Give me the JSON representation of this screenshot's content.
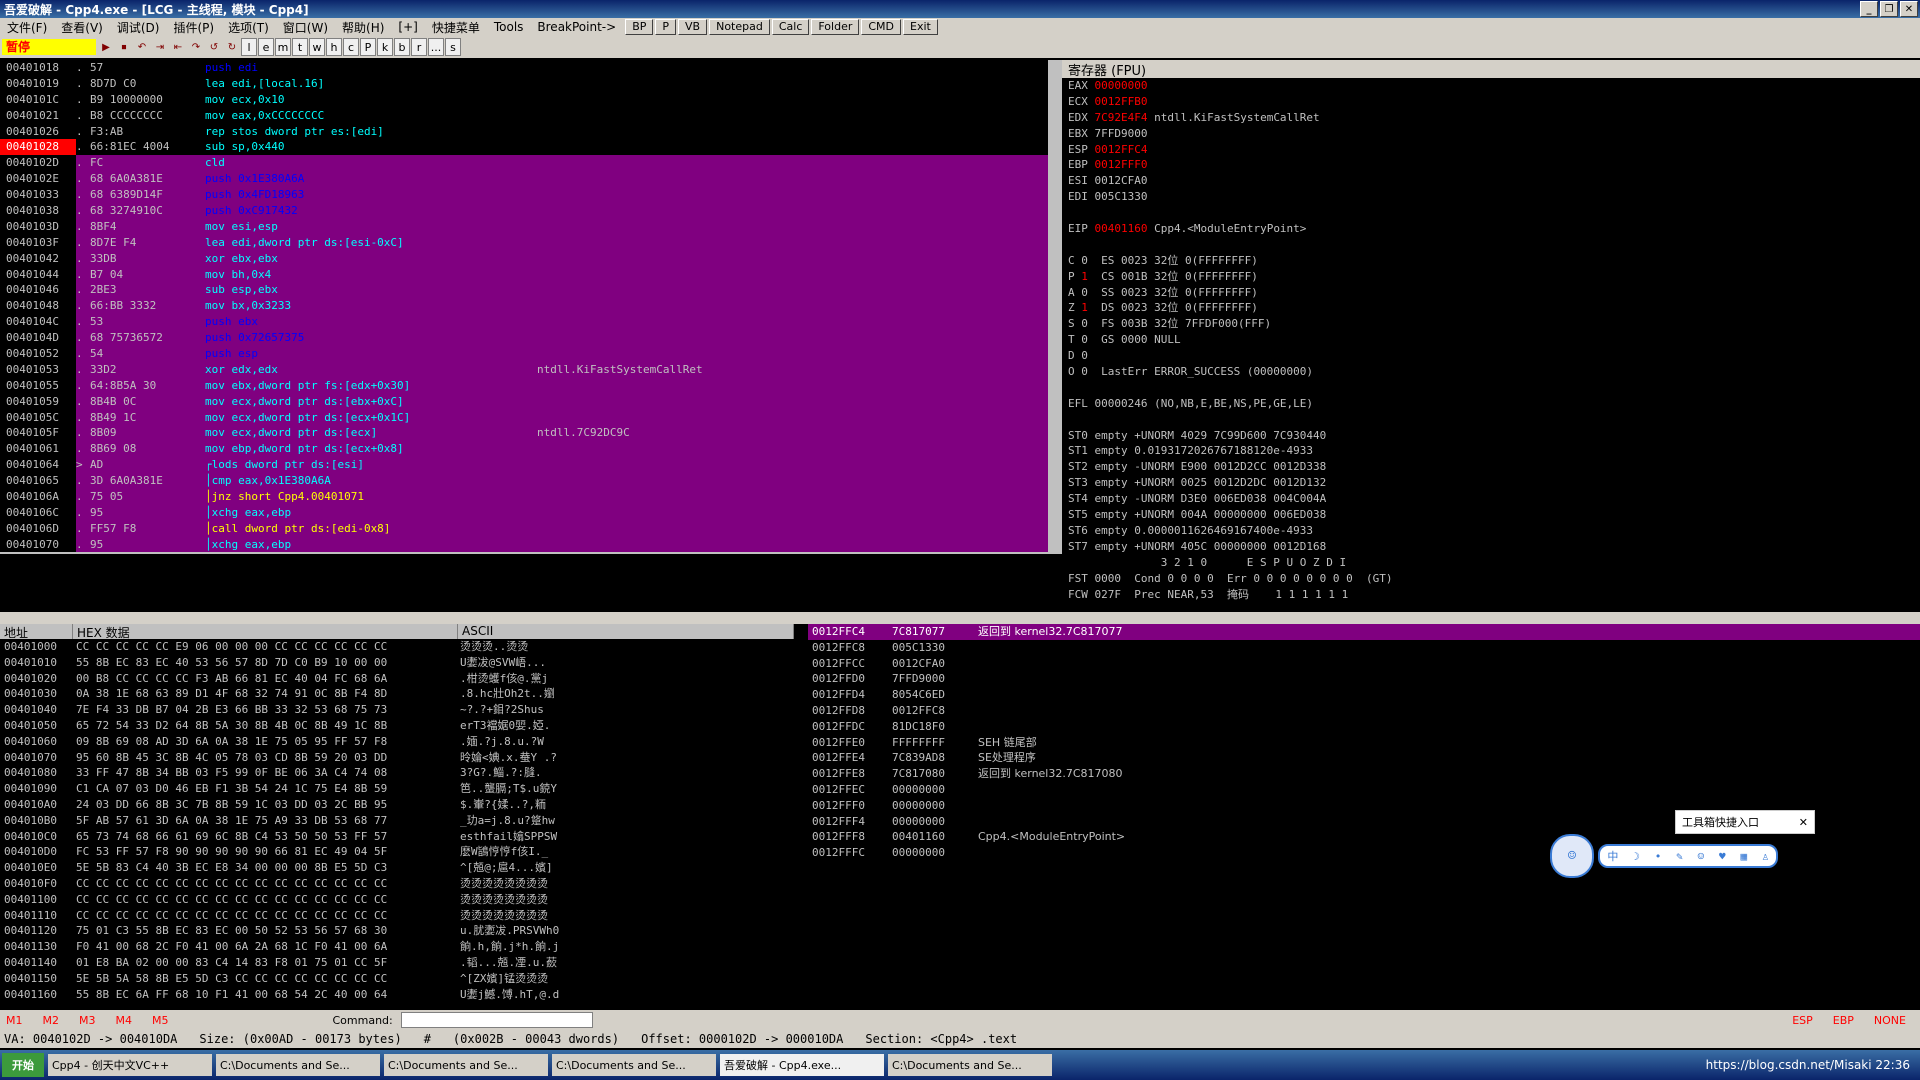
{
  "window": {
    "title": "吾爱破解 - Cpp4.exe - [LCG - 主线程, 模块 - Cpp4]"
  },
  "menu": {
    "items": [
      "文件(F)",
      "查看(V)",
      "调试(D)",
      "插件(P)",
      "选项(T)",
      "窗口(W)",
      "帮助(H)",
      "[+]",
      "快捷菜单",
      "Tools",
      "BreakPoint->"
    ],
    "buttons": [
      "BP",
      "P",
      "VB",
      "Notepad",
      "Calc",
      "Folder",
      "CMD",
      "Exit"
    ]
  },
  "toolbar": {
    "status": "暂停",
    "letters": [
      "l",
      "e",
      "m",
      "t",
      "w",
      "h",
      "c",
      "P",
      "k",
      "b",
      "r",
      "...",
      "s"
    ]
  },
  "disasm": {
    "rows": [
      {
        "addr": "00401018",
        "mk": ".",
        "hex": "57",
        "asm": "push edi",
        "cmt": "",
        "purple": false,
        "eip": false
      },
      {
        "addr": "00401019",
        "mk": ".",
        "hex": "8D7D C0",
        "asm": "lea edi,[local.16]",
        "cmt": "",
        "purple": false,
        "eip": false
      },
      {
        "addr": "0040101C",
        "mk": ".",
        "hex": "B9 10000000",
        "asm": "mov ecx,0x10",
        "cmt": "",
        "purple": false,
        "eip": false
      },
      {
        "addr": "00401021",
        "mk": ".",
        "hex": "B8 CCCCCCCC",
        "asm": "mov eax,0xCCCCCCCC",
        "cmt": "",
        "purple": false,
        "eip": false
      },
      {
        "addr": "00401026",
        "mk": ".",
        "hex": "F3:AB",
        "asm": "rep stos dword ptr es:[edi]",
        "cmt": "",
        "purple": false,
        "eip": false
      },
      {
        "addr": "00401028",
        "mk": ".",
        "hex": "66:81EC 4004",
        "asm": "sub sp,0x440",
        "cmt": "",
        "purple": false,
        "eip": true
      },
      {
        "addr": "0040102D",
        "mk": ".",
        "hex": "FC",
        "asm": "cld",
        "cmt": "",
        "purple": true,
        "eip": false
      },
      {
        "addr": "0040102E",
        "mk": ".",
        "hex": "68 6A0A381E",
        "asm": "push 0x1E380A6A",
        "cmt": "",
        "purple": true,
        "eip": false
      },
      {
        "addr": "00401033",
        "mk": ".",
        "hex": "68 6389D14F",
        "asm": "push 0x4FD18963",
        "cmt": "",
        "purple": true,
        "eip": false
      },
      {
        "addr": "00401038",
        "mk": ".",
        "hex": "68 3274910C",
        "asm": "push 0xC917432",
        "cmt": "",
        "purple": true,
        "eip": false
      },
      {
        "addr": "0040103D",
        "mk": ".",
        "hex": "8BF4",
        "asm": "mov esi,esp",
        "cmt": "",
        "purple": true,
        "eip": false
      },
      {
        "addr": "0040103F",
        "mk": ".",
        "hex": "8D7E F4",
        "asm": "lea edi,dword ptr ds:[esi-0xC]",
        "cmt": "",
        "purple": true,
        "eip": false
      },
      {
        "addr": "00401042",
        "mk": ".",
        "hex": "33DB",
        "asm": "xor ebx,ebx",
        "cmt": "",
        "purple": true,
        "eip": false
      },
      {
        "addr": "00401044",
        "mk": ".",
        "hex": "B7 04",
        "asm": "mov bh,0x4",
        "cmt": "",
        "purple": true,
        "eip": false
      },
      {
        "addr": "00401046",
        "mk": ".",
        "hex": "2BE3",
        "asm": "sub esp,ebx",
        "cmt": "",
        "purple": true,
        "eip": false
      },
      {
        "addr": "00401048",
        "mk": ".",
        "hex": "66:BB 3332",
        "asm": "mov bx,0x3233",
        "cmt": "",
        "purple": true,
        "eip": false
      },
      {
        "addr": "0040104C",
        "mk": ".",
        "hex": "53",
        "asm": "push ebx",
        "cmt": "",
        "purple": true,
        "eip": false
      },
      {
        "addr": "0040104D",
        "mk": ".",
        "hex": "68 75736572",
        "asm": "push 0x72657375",
        "cmt": "",
        "purple": true,
        "eip": false
      },
      {
        "addr": "00401052",
        "mk": ".",
        "hex": "54",
        "asm": "push esp",
        "cmt": "",
        "purple": true,
        "eip": false
      },
      {
        "addr": "00401053",
        "mk": ".",
        "hex": "33D2",
        "asm": "xor edx,edx",
        "cmt": "ntdll.KiFastSystemCallRet",
        "purple": true,
        "eip": false
      },
      {
        "addr": "00401055",
        "mk": ".",
        "hex": "64:8B5A 30",
        "asm": "mov ebx,dword ptr fs:[edx+0x30]",
        "cmt": "",
        "purple": true,
        "eip": false
      },
      {
        "addr": "00401059",
        "mk": ".",
        "hex": "8B4B 0C",
        "asm": "mov ecx,dword ptr ds:[ebx+0xC]",
        "cmt": "",
        "purple": true,
        "eip": false
      },
      {
        "addr": "0040105C",
        "mk": ".",
        "hex": "8B49 1C",
        "asm": "mov ecx,dword ptr ds:[ecx+0x1C]",
        "cmt": "",
        "purple": true,
        "eip": false
      },
      {
        "addr": "0040105F",
        "mk": ".",
        "hex": "8B09",
        "asm": "mov ecx,dword ptr ds:[ecx]",
        "cmt": "ntdll.7C92DC9C",
        "purple": true,
        "eip": false
      },
      {
        "addr": "00401061",
        "mk": ".",
        "hex": "8B69 08",
        "asm": "mov ebp,dword ptr ds:[ecx+0x8]",
        "cmt": "",
        "purple": true,
        "eip": false
      },
      {
        "addr": "00401064",
        "mk": ">",
        "hex": "AD",
        "asm": "┌lods dword ptr ds:[esi]",
        "cmt": "",
        "purple": true,
        "eip": false
      },
      {
        "addr": "00401065",
        "mk": ".",
        "hex": "3D 6A0A381E",
        "asm": "│cmp eax,0x1E380A6A",
        "cmt": "",
        "purple": true,
        "eip": false
      },
      {
        "addr": "0040106A",
        "mk": ".",
        "hex": "75 05",
        "asm": "│jnz short Cpp4.00401071",
        "cmt": "",
        "purple": true,
        "eip": false
      },
      {
        "addr": "0040106C",
        "mk": ".",
        "hex": "95",
        "asm": "│xchg eax,ebp",
        "cmt": "",
        "purple": true,
        "eip": false
      },
      {
        "addr": "0040106D",
        "mk": ".",
        "hex": "FF57 F8",
        "asm": "│call dword ptr ds:[edi-0x8]",
        "cmt": "",
        "purple": true,
        "eip": false
      },
      {
        "addr": "00401070",
        "mk": ".",
        "hex": "95",
        "asm": "│xchg eax,ebp",
        "cmt": "",
        "purple": true,
        "eip": false
      }
    ]
  },
  "registers": {
    "header": "寄存器 (FPU)",
    "lines": [
      {
        "name": "EAX",
        "val": "00000000",
        "txt": "",
        "red": true
      },
      {
        "name": "ECX",
        "val": "0012FFB0",
        "txt": "",
        "red": true
      },
      {
        "name": "EDX",
        "val": "7C92E4F4",
        "txt": "ntdll.KiFastSystemCallRet",
        "red": true
      },
      {
        "name": "EBX",
        "val": "7FFD9000",
        "txt": "",
        "red": false
      },
      {
        "name": "ESP",
        "val": "0012FFC4",
        "txt": "",
        "red": true
      },
      {
        "name": "EBP",
        "val": "0012FFF0",
        "txt": "",
        "red": true
      },
      {
        "name": "ESI",
        "val": "0012CFA0",
        "txt": "",
        "red": false
      },
      {
        "name": "EDI",
        "val": "005C1330",
        "txt": "",
        "red": false
      }
    ],
    "eip": {
      "name": "EIP",
      "val": "00401160",
      "txt": "Cpp4.<ModuleEntryPoint>"
    },
    "flags": [
      {
        "f": "C 0",
        "seg": "ES 0023 32位 0(FFFFFFFF)",
        "red": false
      },
      {
        "f": "P 1",
        "seg": "CS 001B 32位 0(FFFFFFFF)",
        "red": true
      },
      {
        "f": "A 0",
        "seg": "SS 0023 32位 0(FFFFFFFF)",
        "red": false
      },
      {
        "f": "Z 1",
        "seg": "DS 0023 32位 0(FFFFFFFF)",
        "red": true
      },
      {
        "f": "S 0",
        "seg": "FS 003B 32位 7FFDF000(FFF)",
        "red": false
      },
      {
        "f": "T 0",
        "seg": "GS 0000 NULL",
        "red": false
      },
      {
        "f": "D 0",
        "seg": "",
        "red": false
      },
      {
        "f": "O 0",
        "seg": "LastErr ERROR_SUCCESS (00000000)",
        "red": false
      }
    ],
    "efl": "EFL 00000246 (NO,NB,E,BE,NS,PE,GE,LE)",
    "st": [
      "ST0 empty +UNORM 4029 7C99D600 7C930440",
      "ST1 empty 0.0193172026767188120e-4933",
      "ST2 empty -UNORM E900 0012D2CC 0012D338",
      "ST3 empty +UNORM 0025 0012D2DC 0012D132",
      "ST4 empty -UNORM D3E0 006ED038 004C004A",
      "ST5 empty +UNORM 004A 00000000 006ED038",
      "ST6 empty 0.0000011626469167400e-4933",
      "ST7 empty +UNORM 405C 00000000 0012D168"
    ],
    "fpu_hdr": "              3 2 1 0      E S P U O Z D I",
    "fst": "FST 0000  Cond 0 0 0 0  Err 0 0 0 0 0 0 0 0  (GT)",
    "fcw": "FCW 027F  Prec NEAR,53  掩码    1 1 1 1 1 1"
  },
  "dump": {
    "headers": [
      "地址",
      "HEX 数据",
      "ASCII"
    ],
    "rows": [
      {
        "a": "00401000",
        "h": "CC CC CC CC CC E9 06 00 00 00 CC CC CC CC CC CC",
        "s": "烫烫烫..烫烫"
      },
      {
        "a": "00401010",
        "h": "55 8B EC 83 EC 40 53 56 57 8D 7D C0 B9 10 00 00",
        "s": "U嬱冹@SVW峿..."
      },
      {
        "a": "00401020",
        "h": "00 B8 CC CC CC CC F3 AB 66 81 EC 40 04 FC 68 6A",
        "s": ".柑烫蠖f侅@.黨j"
      },
      {
        "a": "00401030",
        "h": "0A 38 1E 68 63 89 D1 4F 68 32 74 91 0C 8B F4 8D",
        "s": ".8.hc壯Oh2t..嬼"
      },
      {
        "a": "00401040",
        "h": "7E F4 33 DB B7 04 2B E3 66 BB 33 32 53 68 75 73",
        "s": "~?.?+鉬?2Shus"
      },
      {
        "a": "00401050",
        "h": "65 72 54 33 D2 64 8B 5A 30 8B 4B 0C 8B 49 1C 8B",
        "s": "erT3襠婮0婯.婭."
      },
      {
        "a": "00401060",
        "h": "09 8B 69 08 AD 3D 6A 0A 38 1E 75 05 95 FF 57 F8",
        "s": ".媔.?j.8.u.?W"
      },
      {
        "a": "00401070",
        "h": "95 60 8B 45 3C 8B 4C 05 78 03 CD 8B 59 20 03 DD",
        "s": "昤婨<婰.x.蛬Y .?"
      },
      {
        "a": "00401080",
        "h": "33 FF 47 8B 34 BB 03 F5 99 0F BE 06 3A C4 74 08",
        "s": "3?G?.鯔.?:膖."
      },
      {
        "a": "00401090",
        "h": "C1 CA 07 03 D0 46 EB F1 3B 54 24 1C 75 E4 8B 59",
        "s": "笆..蠪膈;T$.u鋴Y"
      },
      {
        "a": "004010A0",
        "h": "24 03 DD 66 8B 3C 7B 8B 59 1C 03 DD 03 2C BB 95",
        "s": "$.輋?{媃..?,粫"
      },
      {
        "a": "004010B0",
        "h": "5F AB 57 61 3D 6A 0A 38 1E 75 A9 33 DB 53 68 77",
        "s": "_玏a=j.8.u?跾hw"
      },
      {
        "a": "004010C0",
        "h": "65 73 74 68 66 61 69 6C 8B C4 53 50 50 53 FF 57",
        "s": "esthfail嬆SPPSW"
      },
      {
        "a": "004010D0",
        "h": "FC 53 FF 57 F8 90 90 90 90 90 66 81 EC 49 04 5F",
        "s": "麽W鴲悙悙f侅I._"
      },
      {
        "a": "004010E0",
        "h": "5E 5B 83 C4 40 3B EC E8 34 00 00 00 8B E5 5D C3",
        "s": "^[兡@;扈4...嬪]"
      },
      {
        "a": "004010F0",
        "h": "CC CC CC CC CC CC CC CC CC CC CC CC CC CC CC CC",
        "s": "烫烫烫烫烫烫烫烫"
      },
      {
        "a": "00401100",
        "h": "CC CC CC CC CC CC CC CC CC CC CC CC CC CC CC CC",
        "s": "烫烫烫烫烫烫烫烫"
      },
      {
        "a": "00401110",
        "h": "CC CC CC CC CC CC CC CC CC CC CC CC CC CC CC CC",
        "s": "烫烫烫烫烫烫烫烫"
      },
      {
        "a": "00401120",
        "h": "75 01 C3 55 8B EC 83 EC 00 50 52 53 56 57 68 30",
        "s": "u.肬嬱冹.PRSVWh0"
      },
      {
        "a": "00401130",
        "h": "F0 41 00 68 2C F0 41 00 6A 2A 68 1C F0 41 00 6A",
        "s": "餉.h,餉.j*h.餉.j"
      },
      {
        "a": "00401140",
        "h": "01 E8 BA 02 00 00 83 C4 14 83 F8 01 75 01 CC 5F",
        "s": ".韬...兡.凐.u.蘝"
      },
      {
        "a": "00401150",
        "h": "5E 5B 5A 58 8B E5 5D C3 CC CC CC CC CC CC CC CC",
        "s": "^[ZX嬪]锰烫烫烫"
      },
      {
        "a": "00401160",
        "h": "55 8B EC 6A FF 68 10 F1 41 00 68 54 2C 40 00 64",
        "s": "U嬱j鱤.馎.hT,@.d"
      }
    ]
  },
  "stack": {
    "rows": [
      {
        "a": "0012FFC4",
        "v": "7C817077",
        "c": "返回到 kernel32.7C817077",
        "top": true
      },
      {
        "a": "0012FFC8",
        "v": "005C1330",
        "c": "",
        "top": false
      },
      {
        "a": "0012FFCC",
        "v": "0012CFA0",
        "c": "",
        "top": false
      },
      {
        "a": "0012FFD0",
        "v": "7FFD9000",
        "c": "",
        "top": false
      },
      {
        "a": "0012FFD4",
        "v": "8054C6ED",
        "c": "",
        "top": false
      },
      {
        "a": "0012FFD8",
        "v": "0012FFC8",
        "c": "",
        "top": false
      },
      {
        "a": "0012FFDC",
        "v": "81DC18F0",
        "c": "",
        "top": false
      },
      {
        "a": "0012FFE0",
        "v": "FFFFFFFF",
        "c": "SEH 链尾部",
        "top": false
      },
      {
        "a": "0012FFE4",
        "v": "7C839AD8",
        "c": "SE处理程序",
        "top": false
      },
      {
        "a": "0012FFE8",
        "v": "7C817080",
        "c": "返回到 kernel32.7C817080",
        "top": false
      },
      {
        "a": "0012FFEC",
        "v": "00000000",
        "c": "",
        "top": false
      },
      {
        "a": "0012FFF0",
        "v": "00000000",
        "c": "",
        "top": false
      },
      {
        "a": "0012FFF4",
        "v": "00000000",
        "c": "",
        "top": false
      },
      {
        "a": "0012FFF8",
        "v": "00401160",
        "c": "Cpp4.<ModuleEntryPoint>",
        "top": false
      },
      {
        "a": "0012FFFC",
        "v": "00000000",
        "c": "",
        "top": false
      }
    ]
  },
  "widget": {
    "bubble": "工具箱快捷入口",
    "close": "✕",
    "bar": [
      "中",
      "☽",
      "•",
      "✎",
      "☺",
      "♥",
      "▦",
      "♙"
    ]
  },
  "cmdbar": {
    "markers": [
      "M1",
      "M2",
      "M3",
      "M4",
      "M5"
    ],
    "label": "Command:",
    "right": [
      "ESP",
      "EBP",
      "NONE"
    ]
  },
  "infobar": {
    "items": [
      "VA: 0040102D -> 004010DA",
      "Size: (0x00AD - 00173 bytes)",
      "#",
      "(0x002B - 00043 dwords)",
      "Offset: 0000102D -> 000010DA",
      "Section: <Cpp4> .text"
    ]
  },
  "taskbar": {
    "start": "开始",
    "items": [
      "Cpp4 - 创天中文VC++",
      "C:\\Documents and Se...",
      "C:\\Documents and Se...",
      "C:\\Documents and Se...",
      "吾爱破解 - Cpp4.exe...",
      "C:\\Documents and Se..."
    ],
    "tray": "https://blog.csdn.net/Misaki 22:36"
  }
}
